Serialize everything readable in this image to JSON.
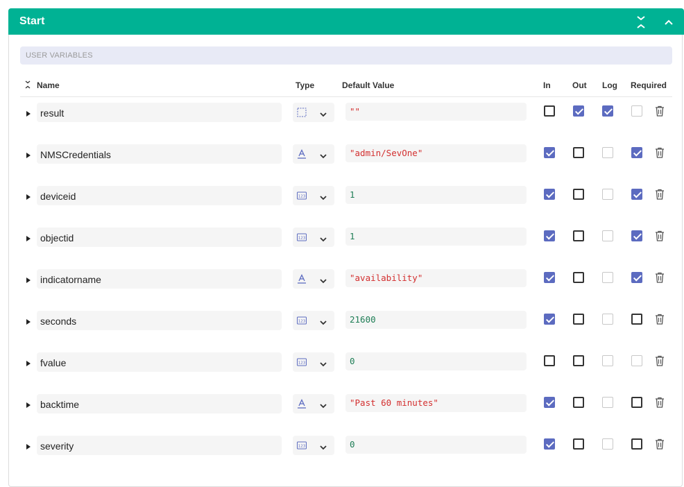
{
  "panel": {
    "title": "Start",
    "collapse_all_icon": "collapse-all-icon",
    "collapse_icon": "chevron-up-icon"
  },
  "section": {
    "label": "USER VARIABLES"
  },
  "columns": {
    "name": "Name",
    "type": "Type",
    "default_value": "Default Value",
    "in": "In",
    "out": "Out",
    "log": "Log",
    "required": "Required"
  },
  "colors": {
    "header": "#00b294",
    "checkbox_checked": "#5c6bc0",
    "string_value": "#d32f2f",
    "number_value": "#1e7d55"
  },
  "variables": [
    {
      "name": "result",
      "type_icon": "any-type-icon",
      "default_value": "\"\"",
      "value_kind": "string",
      "in": false,
      "out": true,
      "log": true,
      "log_disabled": false,
      "required": false,
      "required_disabled": true
    },
    {
      "name": "NMSCredentials",
      "type_icon": "text-type-icon",
      "default_value": "\"admin/SevOne\"",
      "value_kind": "string",
      "in": true,
      "out": false,
      "log": false,
      "log_disabled": true,
      "required": true,
      "required_disabled": false
    },
    {
      "name": "deviceid",
      "type_icon": "number-type-icon",
      "default_value": "1",
      "value_kind": "number",
      "in": true,
      "out": false,
      "log": false,
      "log_disabled": true,
      "required": true,
      "required_disabled": false
    },
    {
      "name": "objectid",
      "type_icon": "number-type-icon",
      "default_value": "1",
      "value_kind": "number",
      "in": true,
      "out": false,
      "log": false,
      "log_disabled": true,
      "required": true,
      "required_disabled": false
    },
    {
      "name": "indicatorname",
      "type_icon": "text-type-icon",
      "default_value": "\"availability\"",
      "value_kind": "string",
      "in": true,
      "out": false,
      "log": false,
      "log_disabled": true,
      "required": true,
      "required_disabled": false
    },
    {
      "name": "seconds",
      "type_icon": "number-type-icon",
      "default_value": "21600",
      "value_kind": "number",
      "in": true,
      "out": false,
      "log": false,
      "log_disabled": true,
      "required": false,
      "required_disabled": false
    },
    {
      "name": "fvalue",
      "type_icon": "number-type-icon",
      "default_value": "0",
      "value_kind": "number",
      "in": false,
      "out": false,
      "log": false,
      "log_disabled": true,
      "required": false,
      "required_disabled": true
    },
    {
      "name": "backtime",
      "type_icon": "text-type-icon",
      "default_value": "\"Past 60 minutes\"",
      "value_kind": "string",
      "in": true,
      "out": false,
      "log": false,
      "log_disabled": true,
      "required": false,
      "required_disabled": false
    },
    {
      "name": "severity",
      "type_icon": "number-type-icon",
      "default_value": "0",
      "value_kind": "number",
      "in": true,
      "out": false,
      "log": false,
      "log_disabled": true,
      "required": false,
      "required_disabled": false
    }
  ]
}
